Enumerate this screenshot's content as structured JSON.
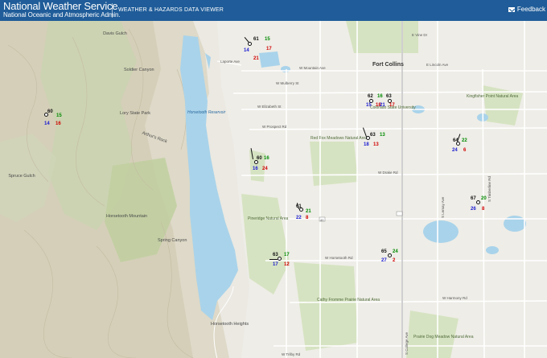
{
  "header": {
    "title": "National Weather Service",
    "subtitle": "National Oceanic and Atmospheric Admin.",
    "viewer_label": "WEATHER & HAZARDS DATA VIEWER",
    "feedback_label": "Feedback"
  },
  "map": {
    "labels": {
      "city": "Fort Collins",
      "reservoir": "Horsetooth Reservoir",
      "heights": "Horsetooth Heights",
      "red_fox": "Red Fox Meadows Natural Area",
      "csu": "Colorado State University",
      "kingfisher": "Kingfisher Point Natural Area",
      "pineridge": "Pineridge Natural Area",
      "cathy": "Cathy Fromme Prairie Natural Area",
      "prairie_dog": "Prairie Dog Meadow Natural Area",
      "davis": "Davis Gulch",
      "soldier": "Soldier Canyon",
      "lory": "Lory State Park",
      "arthurs": "Arthur's Rock",
      "spruce": "Spruce Gulch",
      "horsetooth_mtn": "Horsetooth Mountain",
      "spring": "Spring Canyon",
      "mulberry": "W Mulberry St",
      "elizabeth": "W Elizabeth St",
      "prospect": "W Prospect Rd",
      "drake": "W Drake Rd",
      "horsetooth_rd": "W Horsetooth Rd",
      "mountain": "W Mountain Ave",
      "laporte": "Laporte Ave",
      "lincoln": "E Lincoln Ave",
      "vine": "E Vine Dr",
      "college": "S College Ave",
      "timberline": "S Timberline Rd",
      "lemay": "S Lemay Ave",
      "harmony": "W Harmony Rd",
      "trilby": "W Trilby Rd",
      "route": "40"
    },
    "stations": [
      {
        "t": "61",
        "td": "15",
        "spd": "14",
        "gust": "17",
        "vis": "21"
      },
      {
        "t": "60",
        "td": "15",
        "spd": "14",
        "gust": "",
        "vis": "16"
      },
      {
        "t": "60",
        "td": "16",
        "spd": "16",
        "gust": "",
        "vis": "24"
      },
      {
        "t": "62",
        "td": "16",
        "spd": "15",
        "gust": "",
        "vis": "18"
      },
      {
        "t": "63",
        "td": "",
        "spd": "21",
        "gust": "",
        "vis": "17"
      },
      {
        "t": "63",
        "td": "13",
        "spd": "18",
        "gust": "",
        "vis": "13"
      },
      {
        "t": "64",
        "td": "22",
        "spd": "24",
        "gust": "",
        "vis": "6"
      },
      {
        "t": "67",
        "td": "20",
        "spd": "26",
        "gust": "",
        "vis": "8"
      },
      {
        "t": "61",
        "td": "21",
        "spd": "22",
        "gust": "",
        "vis": "8"
      },
      {
        "t": "65",
        "td": "24",
        "spd": "27",
        "gust": "",
        "vis": "2"
      },
      {
        "t": "63",
        "td": "17",
        "spd": "17",
        "gust": "",
        "vis": "12"
      }
    ]
  },
  "colors": {
    "header_bg": "#1f5c99",
    "water": "#a9d3ea",
    "temp": "#d00000",
    "dewpoint": "#008a00",
    "wind": "#1a1ad0"
  }
}
